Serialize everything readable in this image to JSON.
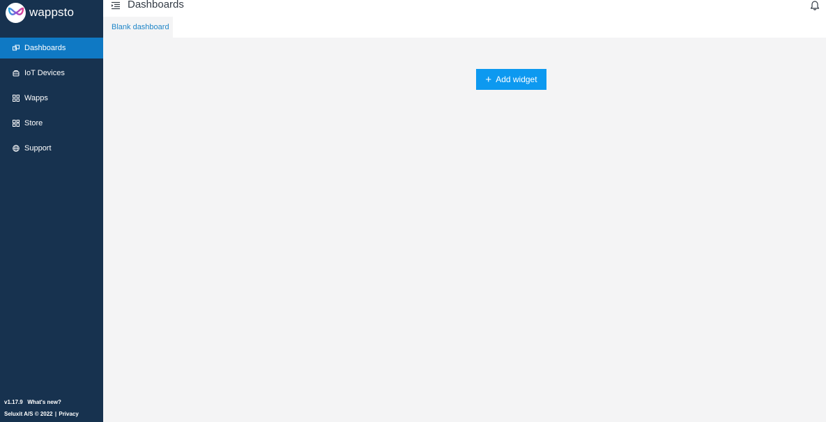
{
  "brand": {
    "name": "wappsto"
  },
  "sidebar": {
    "items": [
      {
        "label": "Dashboards",
        "icon": "dashboard-icon",
        "active": true
      },
      {
        "label": "IoT Devices",
        "icon": "device-icon",
        "active": false
      },
      {
        "label": "Wapps",
        "icon": "apps-grid-icon",
        "active": false
      },
      {
        "label": "Store",
        "icon": "store-icon",
        "active": false
      },
      {
        "label": "Support",
        "icon": "globe-icon",
        "active": false
      }
    ],
    "footer": {
      "version": "v1.17.9",
      "whats_new": "What's new?",
      "copyright": "Seluxit A/S © 2022",
      "separator": "|",
      "privacy": "Privacy"
    }
  },
  "header": {
    "title": "Dashboards"
  },
  "tabs": [
    {
      "label": "Blank dashboard",
      "active": true
    }
  ],
  "content": {
    "add_widget_label": "Add widget",
    "plus": "+"
  },
  "colors": {
    "sidebar_bg": "#17324f",
    "active_item": "#0f79c4",
    "accent_button": "#0d99f0",
    "tab_text": "#1f86c8",
    "content_bg": "#f4f4f5"
  }
}
